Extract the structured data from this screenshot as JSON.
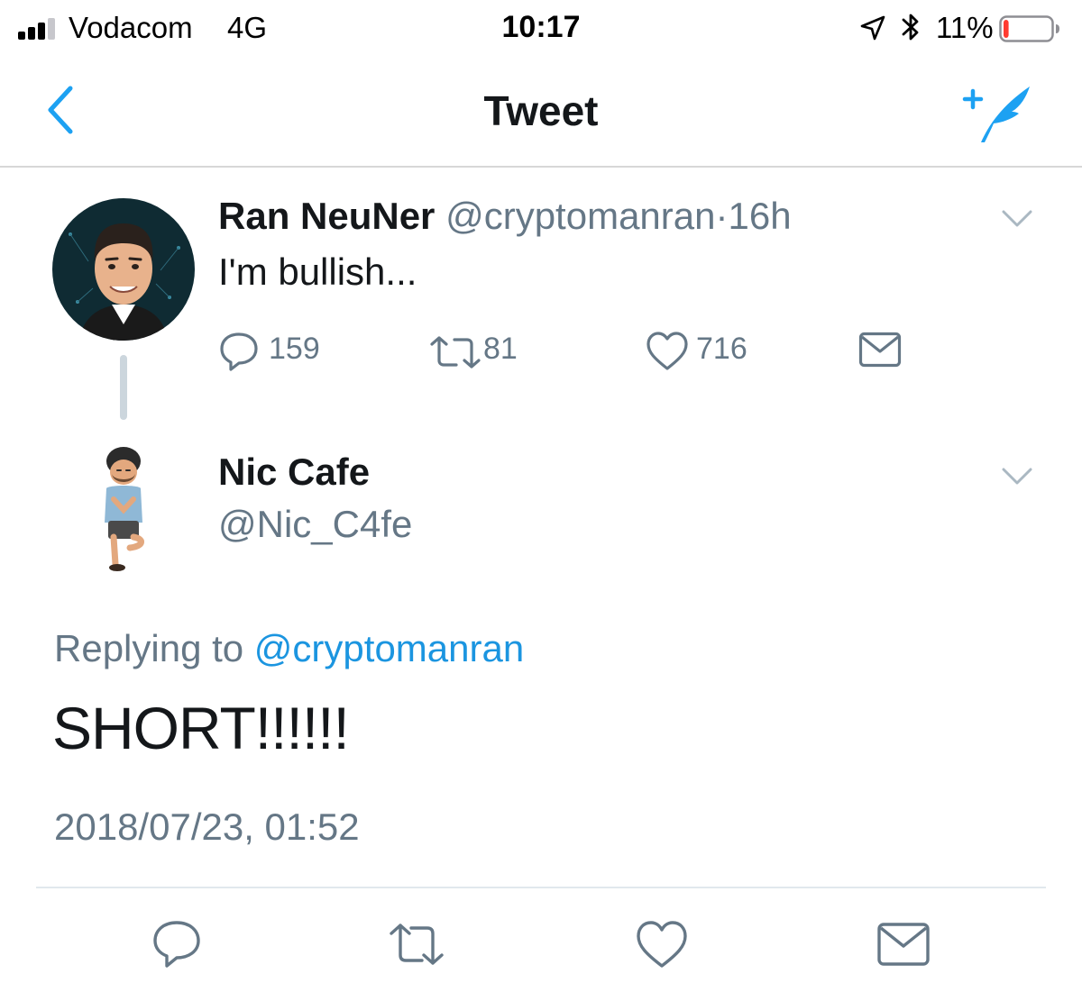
{
  "status_bar": {
    "carrier": "Vodacom",
    "network": "4G",
    "time": "10:17",
    "battery_percent": "11%",
    "battery_level": 0.11,
    "icons": [
      "signal-icon",
      "location-arrow-icon",
      "bluetooth-icon",
      "battery-icon"
    ]
  },
  "nav": {
    "title": "Tweet",
    "back_icon": "chevron-left-icon",
    "compose_icon": "compose-tweet-icon"
  },
  "parent_tweet": {
    "name": "Ran NeuNer",
    "handle": "@cryptomanran",
    "separator": "·",
    "time": "16h",
    "text": "I'm bullish...",
    "replies": "159",
    "retweets": "81",
    "likes": "716"
  },
  "reply_tweet": {
    "name": "Nic Cafe",
    "handle": "@Nic_C4fe",
    "replying_prefix": "Replying to",
    "replying_to": "@cryptomanran",
    "text": "SHORT!!!!!!",
    "timestamp": "2018/07/23, 01:52"
  },
  "colors": {
    "accent": "#1da1f2",
    "text": "#14171a",
    "secondary": "#657786",
    "battery_low": "#ff3b30"
  }
}
